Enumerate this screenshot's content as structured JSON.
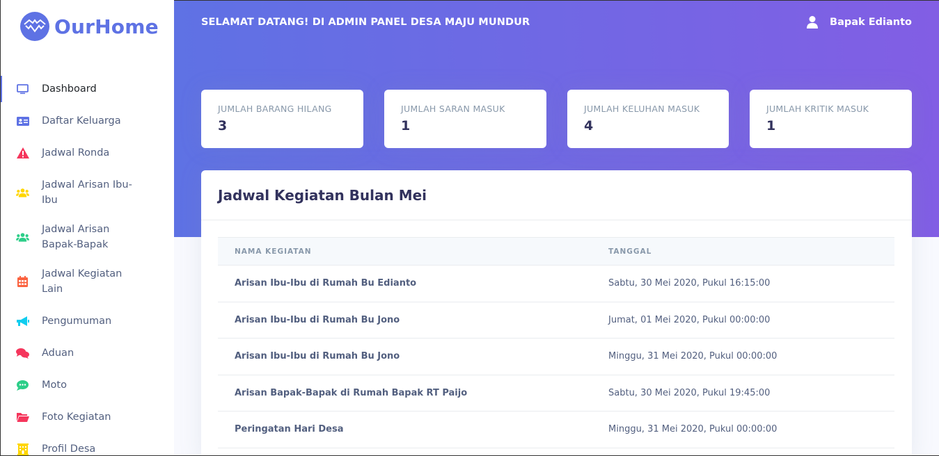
{
  "brand": {
    "name": "OurHome",
    "color": "#5e72e4"
  },
  "header": {
    "welcome": "SELAMAT DATANG! DI ADMIN PANEL DESA MAJU MUNDUR",
    "user_name": "Bapak Edianto",
    "user_icon": "user-icon"
  },
  "sidebar": {
    "items": [
      {
        "label": "Dashboard",
        "icon": "monitor-icon",
        "color": "#5e72e4",
        "active": true
      },
      {
        "label": "Daftar Keluarga",
        "icon": "id-card-icon",
        "color": "#5e72e4"
      },
      {
        "label": "Jadwal Ronda",
        "icon": "warning-icon",
        "color": "#f5365c"
      },
      {
        "label": "Jadwal Arisan Ibu-Ibu",
        "icon": "users-icon",
        "color": "#ffd600"
      },
      {
        "label": "Jadwal Arisan Bapak-Bapak",
        "icon": "users-icon",
        "color": "#2dce89"
      },
      {
        "label": "Jadwal Kegiatan Lain",
        "icon": "calendar-icon",
        "color": "#fb6340"
      },
      {
        "label": "Pengumuman",
        "icon": "megaphone-icon",
        "color": "#11cdef"
      },
      {
        "label": "Aduan",
        "icon": "comments-icon",
        "color": "#f5365c"
      },
      {
        "label": "Moto",
        "icon": "comment-dots-icon",
        "color": "#2dce89"
      },
      {
        "label": "Foto Kegiatan",
        "icon": "folder-open-icon",
        "color": "#f5365c"
      },
      {
        "label": "Profil Desa",
        "icon": "building-icon",
        "color": "#ffd600"
      }
    ]
  },
  "stats": [
    {
      "title": "JUMLAH BARANG HILANG",
      "value": "3"
    },
    {
      "title": "JUMLAH SARAN MASUK",
      "value": "1"
    },
    {
      "title": "JUMLAH KELUHAN MASUK",
      "value": "4"
    },
    {
      "title": "JUMLAH KRITIK MASUK",
      "value": "1"
    }
  ],
  "schedule": {
    "title": "Jadwal Kegiatan Bulan Mei",
    "columns": [
      "NAMA KEGIATAN",
      "TANGGAL"
    ],
    "rows": [
      {
        "name": "Arisan Ibu-Ibu di Rumah Bu Edianto",
        "date": "Sabtu, 30 Mei 2020, Pukul 16:15:00"
      },
      {
        "name": "Arisan Ibu-Ibu di Rumah Bu Jono",
        "date": "Jumat, 01 Mei 2020, Pukul 00:00:00"
      },
      {
        "name": "Arisan Ibu-Ibu di Rumah Bu Jono",
        "date": "Minggu, 31 Mei 2020, Pukul 00:00:00"
      },
      {
        "name": "Arisan Bapak-Bapak di Rumah Bapak RT Paijo",
        "date": "Sabtu, 30 Mei 2020, Pukul 19:45:00"
      },
      {
        "name": "Peringatan Hari Desa",
        "date": "Minggu, 31 Mei 2020, Pukul 00:00:00"
      }
    ]
  },
  "colors": {
    "gradient_start": "#5e72e4",
    "gradient_end": "#825ee4",
    "text_dark": "#32325d",
    "text_muted": "#8898aa"
  }
}
